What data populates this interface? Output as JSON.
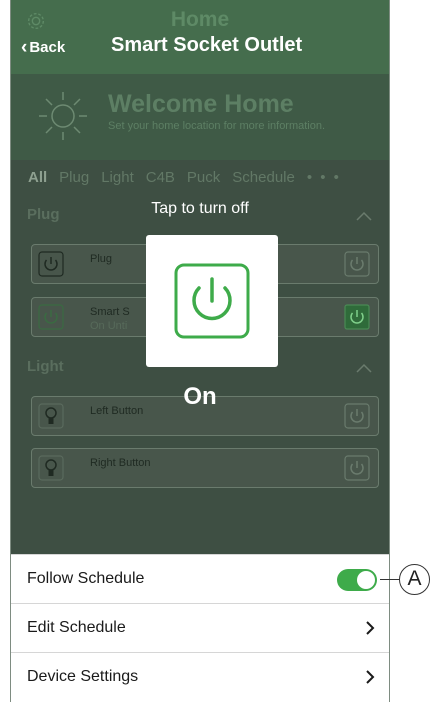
{
  "header": {
    "background_title": "Home",
    "back_label": "Back",
    "title": "Smart Socket Outlet"
  },
  "welcome": {
    "title": "Welcome Home",
    "subtitle": "Set your home location for more information."
  },
  "tabs": [
    {
      "label": "All"
    },
    {
      "label": "Plug"
    },
    {
      "label": "Light"
    },
    {
      "label": "C4B"
    },
    {
      "label": "Puck"
    },
    {
      "label": "Schedule"
    }
  ],
  "tabs_more": "• • •",
  "sections": {
    "plug": {
      "label": "Plug",
      "devices": [
        {
          "name": "Plug",
          "status": ""
        },
        {
          "name": "Smart S",
          "status": "On Unti"
        }
      ]
    },
    "light": {
      "label": "Light",
      "devices": [
        {
          "name": "Left Button"
        },
        {
          "name": "Right Button"
        }
      ]
    }
  },
  "overlay": {
    "tap_text": "Tap to turn off",
    "state": "On"
  },
  "sheet": {
    "follow_schedule": {
      "label": "Follow Schedule",
      "enabled": true
    },
    "edit_schedule": "Edit Schedule",
    "device_settings": "Device Settings"
  },
  "callout": "A",
  "colors": {
    "accent_green": "#3eab4a",
    "header_green": "#456d4d"
  }
}
